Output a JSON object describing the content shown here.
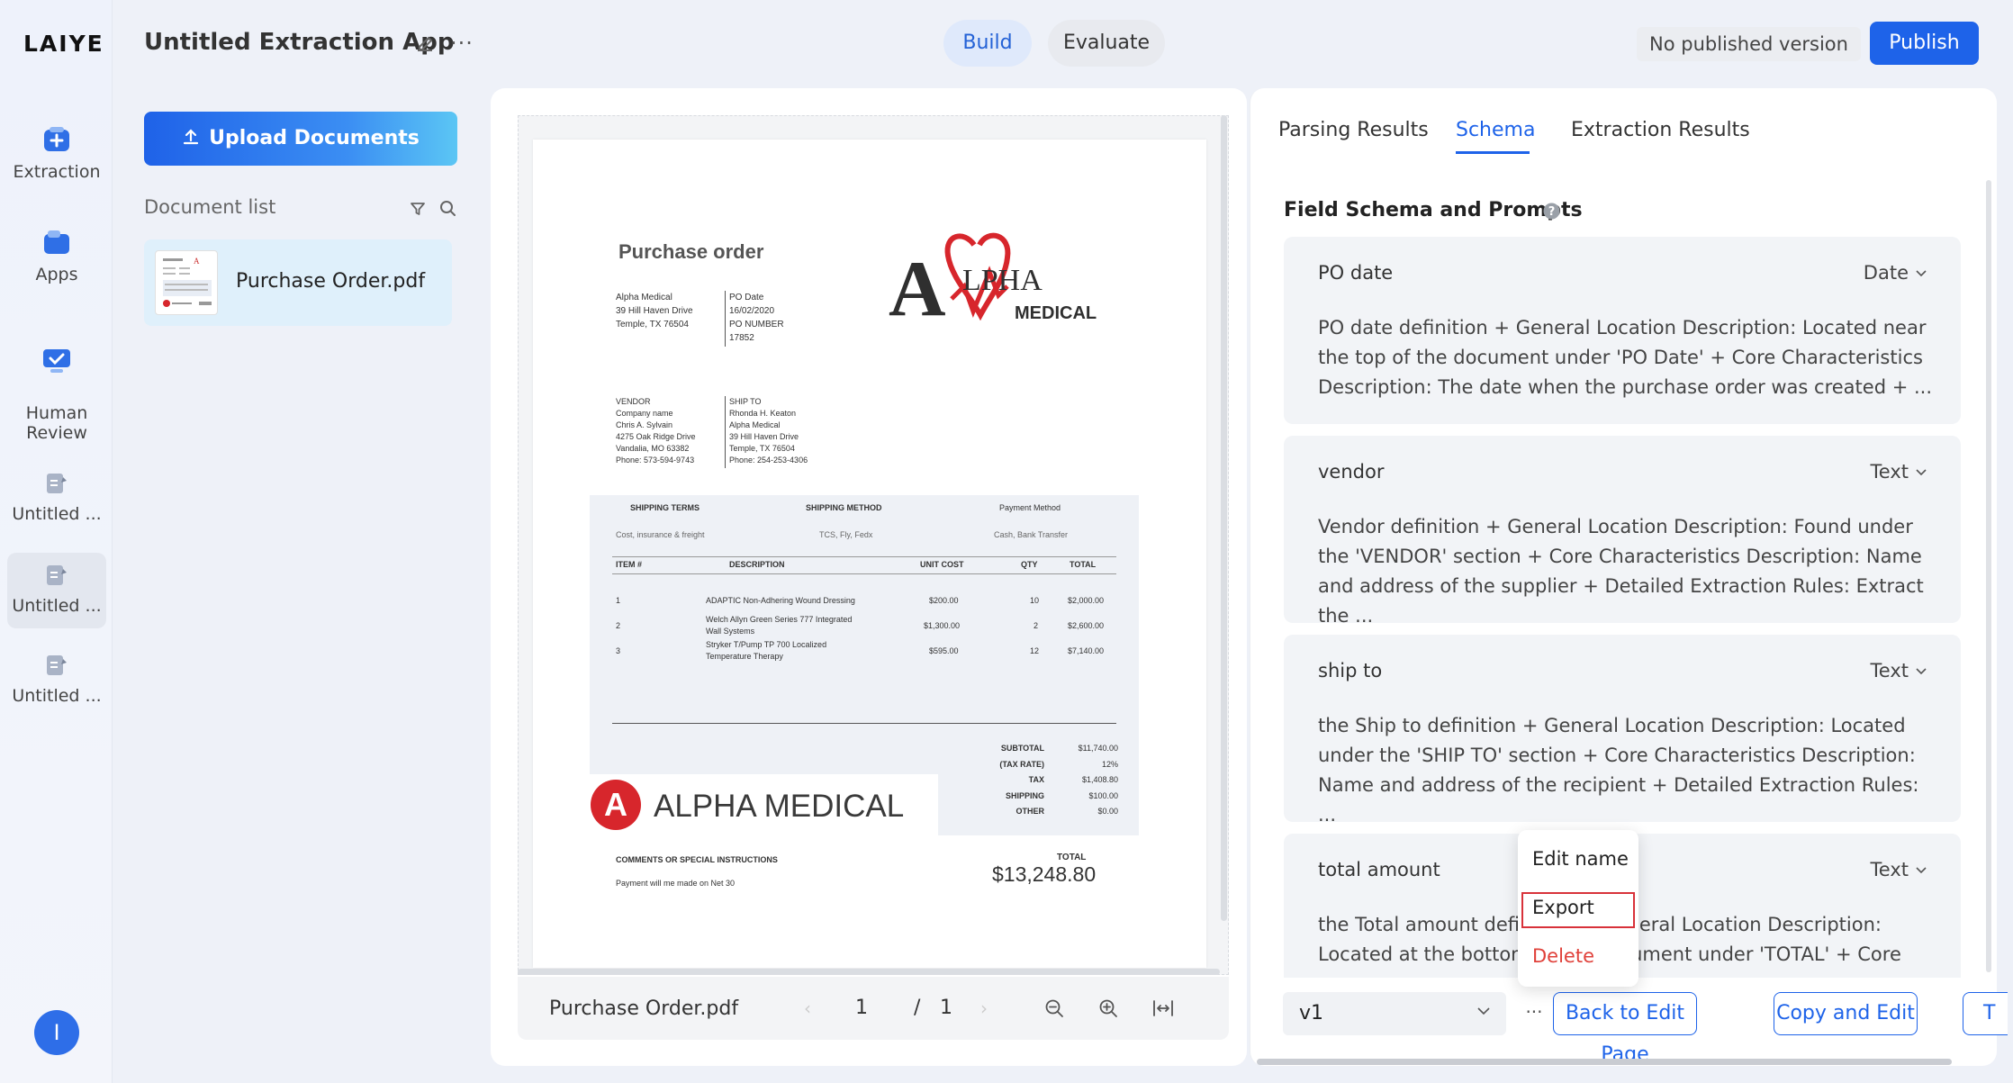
{
  "brand": {
    "logo": "LAIYE"
  },
  "rail": {
    "items": [
      {
        "label": "Extraction",
        "icon": "extraction-icon"
      },
      {
        "label": "Apps",
        "icon": "apps-icon"
      },
      {
        "label": "Human\nReview",
        "icon": "human-review-icon"
      },
      {
        "label": "Untitled ...",
        "icon": "app-doc-icon"
      },
      {
        "label": "Untitled ...",
        "icon": "app-doc-icon"
      },
      {
        "label": "Untitled ...",
        "icon": "app-doc-icon"
      }
    ],
    "avatar": "I"
  },
  "header": {
    "title": "Untitled Extraction App",
    "more": "···",
    "tabs": [
      "Build",
      "Evaluate"
    ],
    "publish_state": "No published version",
    "publish_label": "Publish"
  },
  "documents": {
    "upload_label": "Upload Documents",
    "list_label": "Document list",
    "items": [
      {
        "name": "Purchase Order.pdf"
      }
    ]
  },
  "viewer": {
    "file_name": "Purchase Order.pdf",
    "page": "1",
    "page_sep": "/",
    "total_pages": "1",
    "prev": "‹",
    "next": "›",
    "doc": {
      "title": "Purchase order",
      "from_lines": [
        "Alpha Medical",
        "39 Hill Haven Drive",
        "Temple, TX 76504"
      ],
      "po_lines": [
        "PO Date",
        "16/02/2020",
        "PO NUMBER",
        "17852"
      ],
      "logo_top": "LPHA",
      "logo_initial": "A",
      "logo_sub": "MEDICAL",
      "vendor_lines": [
        "VENDOR",
        "Company name",
        "Chris A. Sylvain",
        "4275 Oak Ridge Drive",
        "Vandalia, MO 63382",
        "Phone: 573-594-9743"
      ],
      "shipto_lines": [
        "SHIP TO",
        "Rhonda H. Keaton",
        "Alpha Medical",
        "39 Hill Haven Drive",
        "Temple, TX 76504",
        "Phone: 254-253-4306"
      ],
      "terms_headers": [
        "SHIPPING TERMS",
        "SHIPPING METHOD",
        "Payment Method"
      ],
      "terms_values": [
        "Cost, insurance & freight",
        "TCS, Fly, Fedx",
        "Cash, Bank Transfer"
      ],
      "item_headers": [
        "ITEM #",
        "DESCRIPTION",
        "UNIT COST",
        "QTY",
        "TOTAL"
      ],
      "items": [
        {
          "no": "1",
          "desc": [
            "ADAPTIC Non-Adhering Wound Dressing"
          ],
          "unit": "$200.00",
          "qty": "10",
          "total": "$2,000.00"
        },
        {
          "no": "2",
          "desc": [
            "Welch Allyn Green Series 777 Integrated",
            "Wall Systems"
          ],
          "unit": "$1,300.00",
          "qty": "2",
          "total": "$2,600.00"
        },
        {
          "no": "3",
          "desc": [
            "Stryker T/Pump TP 700 Localized",
            "Temperature Therapy"
          ],
          "unit": "$595.00",
          "qty": "12",
          "total": "$7,140.00"
        }
      ],
      "summary": [
        {
          "label": "SUBTOTAL",
          "value": "$11,740.00"
        },
        {
          "label": "(TAX RATE)",
          "value": "12%"
        },
        {
          "label": "TAX",
          "value": "$1,408.80"
        },
        {
          "label": "SHIPPING",
          "value": "$100.00"
        },
        {
          "label": "OTHER",
          "value": "$0.00"
        }
      ],
      "watermark_text": "ALPHA MEDICAL",
      "watermark_initial": "A",
      "comments_label": "COMMENTS OR SPECIAL INSTRUCTIONS",
      "comments_text": "Payment will me made on Net 30",
      "total_label": "TOTAL",
      "total_value": "$13,248.80"
    }
  },
  "right": {
    "tabs": [
      "Parsing Results",
      "Schema",
      "Extraction Results"
    ],
    "schema_title": "Field Schema and Prompts",
    "fields": [
      {
        "name": "PO date",
        "type": "Date",
        "desc": "PO date definition + General Location Description: Located near the top of the document under 'PO Date' + Core Characteristics Description: The date when the purchase order was created + ..."
      },
      {
        "name": "vendor",
        "type": "Text",
        "desc": "Vendor definition + General Location Description: Found under the 'VENDOR' section + Core Characteristics Description: Name and address of the supplier + Detailed Extraction Rules: Extract the ..."
      },
      {
        "name": "ship to",
        "type": "Text",
        "desc": "the Ship to definition + General Location Description: Located under the 'SHIP TO' section + Core Characteristics Description: Name and address of the recipient + Detailed Extraction Rules: ..."
      },
      {
        "name": "total amount",
        "type": "Text",
        "desc": "the Total amount definition + General Location Description: Located at the bottom of the document under 'TOTAL' + Core"
      }
    ],
    "version": "v1",
    "more": "···",
    "buttons": [
      "Back to Edit Page",
      "Copy and Edit",
      "T"
    ],
    "menu": [
      "Edit name",
      "Export",
      "Delete"
    ]
  },
  "colors": {
    "accent": "#1e63e9",
    "danger": "#e0413a",
    "logo_red": "#d7262c"
  }
}
